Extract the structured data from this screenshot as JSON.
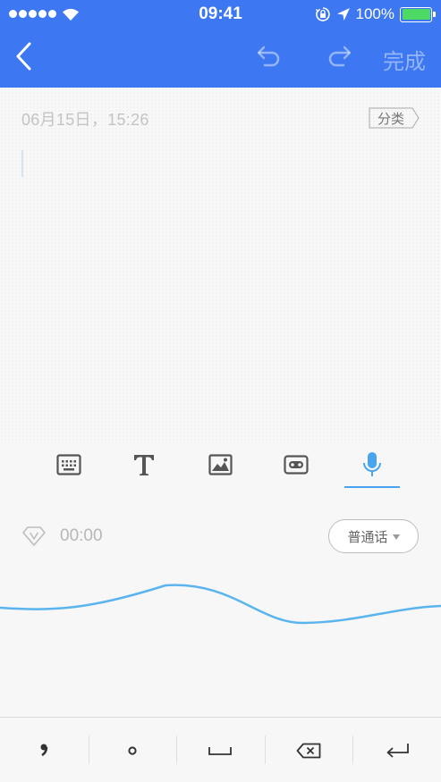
{
  "status_bar": {
    "time": "09:41",
    "battery": "100%"
  },
  "nav_bar": {
    "done_label": "完成",
    "icons": [
      "back-chevron-icon",
      "undo-icon",
      "redo-icon"
    ]
  },
  "editor": {
    "date": "06月15日，15:26",
    "category_label": "分类"
  },
  "toolbar": {
    "tools": [
      "keyboard-icon",
      "text-format-icon",
      "image-icon",
      "cassette-tape-icon",
      "microphone-icon"
    ],
    "selected_tool": "microphone-icon"
  },
  "voice": {
    "timer": "00:00",
    "language": "普通话"
  },
  "keys": [
    "comma-icon",
    "period-icon",
    "space-icon",
    "backspace-icon",
    "enter-icon"
  ],
  "colors": {
    "primary": "#3d78f2",
    "accent": "#4aa3ee",
    "waveform": "#5ab4ee",
    "battery": "#4cd964"
  }
}
